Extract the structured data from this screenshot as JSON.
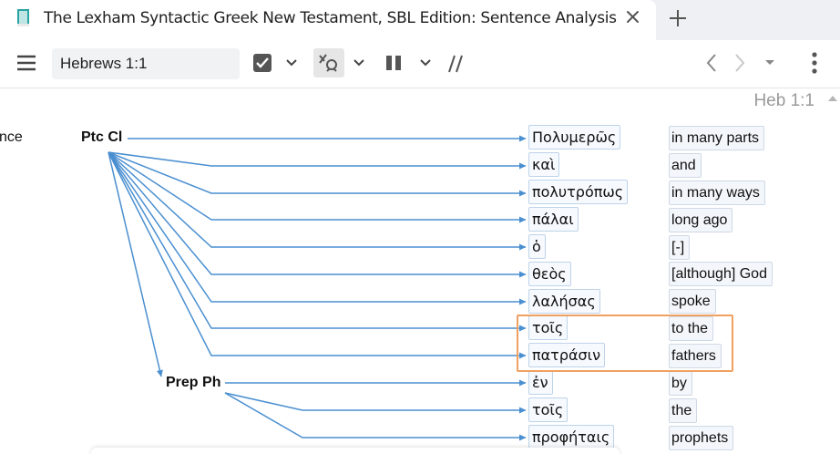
{
  "tab": {
    "title": "The Lexham Syntactic Greek New Testament, SBL Edition: Sentence Analysis",
    "icon": "book-icon"
  },
  "toolbar": {
    "reference_value": "Hebrews 1:1",
    "icons": [
      "menu-icon",
      "checkbox-icon",
      "interlinear-link-icon",
      "columns-icon",
      "parallel-slash-icon",
      "back-arrow-icon",
      "forward-arrow-icon",
      "more-vertical-icon"
    ]
  },
  "content": {
    "verse_ref": "Heb 1:1",
    "left_cut_label": "nce",
    "clauses": [
      "Ptc Cl",
      "Prep Ph"
    ],
    "rows": [
      {
        "greek": "Πολυμερῶς",
        "english": "in many parts"
      },
      {
        "greek": "καὶ",
        "english": "and"
      },
      {
        "greek": "πολυτρόπως",
        "english": "in many ways"
      },
      {
        "greek": "πάλαι",
        "english": "long ago"
      },
      {
        "greek": "ὁ",
        "english": "[-]"
      },
      {
        "greek": "θεὸς",
        "english": "[although] God"
      },
      {
        "greek": "λαλήσας",
        "english": "spoke"
      },
      {
        "greek": "τοῖς",
        "english": "to the"
      },
      {
        "greek": "πατράσιν",
        "english": "fathers"
      },
      {
        "greek": "ἐν",
        "english": "by"
      },
      {
        "greek": "τοῖς",
        "english": "the"
      },
      {
        "greek": "προφήταις",
        "english": "prophets"
      }
    ]
  },
  "colors": {
    "arrow": "#4a8fd0",
    "highlight_border": "#f0a060",
    "box_border": "#bfd3ea"
  }
}
